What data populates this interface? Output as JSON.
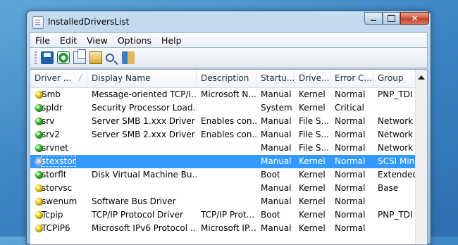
{
  "window": {
    "title": "InstalledDriversList"
  },
  "menu": [
    "File",
    "Edit",
    "View",
    "Options",
    "Help"
  ],
  "toolbar": [
    "save-icon",
    "refresh-icon",
    "copy-icon",
    "properties-icon",
    "find-icon",
    "exit-icon"
  ],
  "columns": [
    "Driver ...",
    "Display Name",
    "Description",
    "Startu...",
    "Drive...",
    "Error C...",
    "Group"
  ],
  "rows": [
    {
      "status": "yellow",
      "name": "Smb",
      "display": "Message-oriented TCP/I...",
      "desc": "Microsoft N...",
      "startup": "Manual",
      "type": "Kernel",
      "error": "Normal",
      "group": "PNP_TDI"
    },
    {
      "status": "green",
      "name": "spldr",
      "display": "Security Processor Load...",
      "desc": "",
      "startup": "System",
      "type": "Kernel",
      "error": "Critical",
      "group": ""
    },
    {
      "status": "green",
      "name": "srv",
      "display": "Server SMB 1.xxx Driver",
      "desc": "Enables con...",
      "startup": "Manual",
      "type": "File S...",
      "error": "Normal",
      "group": "Network"
    },
    {
      "status": "green",
      "name": "srv2",
      "display": "Server SMB 2.xxx Driver",
      "desc": "Enables con...",
      "startup": "Manual",
      "type": "File S...",
      "error": "Normal",
      "group": "Network"
    },
    {
      "status": "green",
      "name": "srvnet",
      "display": "",
      "desc": "",
      "startup": "Manual",
      "type": "File S...",
      "error": "Normal",
      "group": "Network"
    },
    {
      "status": "hatched",
      "name": "stexstor",
      "display": "",
      "desc": "",
      "startup": "Manual",
      "type": "Kernel",
      "error": "Normal",
      "group": "SCSI Min",
      "selected": true
    },
    {
      "status": "green",
      "name": "storflt",
      "display": "Disk Virtual Machine Bu...",
      "desc": "",
      "startup": "Boot",
      "type": "Kernel",
      "error": "Normal",
      "group": "Extended"
    },
    {
      "status": "yellow",
      "name": "storvsc",
      "display": "",
      "desc": "",
      "startup": "Manual",
      "type": "Kernel",
      "error": "Normal",
      "group": "Base"
    },
    {
      "status": "yellow",
      "name": "swenum",
      "display": "Software Bus Driver",
      "desc": "",
      "startup": "Manual",
      "type": "Kernel",
      "error": "Normal",
      "group": ""
    },
    {
      "status": "yellow",
      "name": "Tcpip",
      "display": "TCP/IP Protocol Driver",
      "desc": "TCP/IP Prot...",
      "startup": "Boot",
      "type": "Kernel",
      "error": "Normal",
      "group": "PNP_TDI"
    },
    {
      "status": "yellow",
      "name": "TCPIP6",
      "display": "Microsoft IPv6 Protocol ...",
      "desc": "Microsoft IP...",
      "startup": "Manual",
      "type": "Kernel",
      "error": "Normal",
      "group": ""
    }
  ]
}
